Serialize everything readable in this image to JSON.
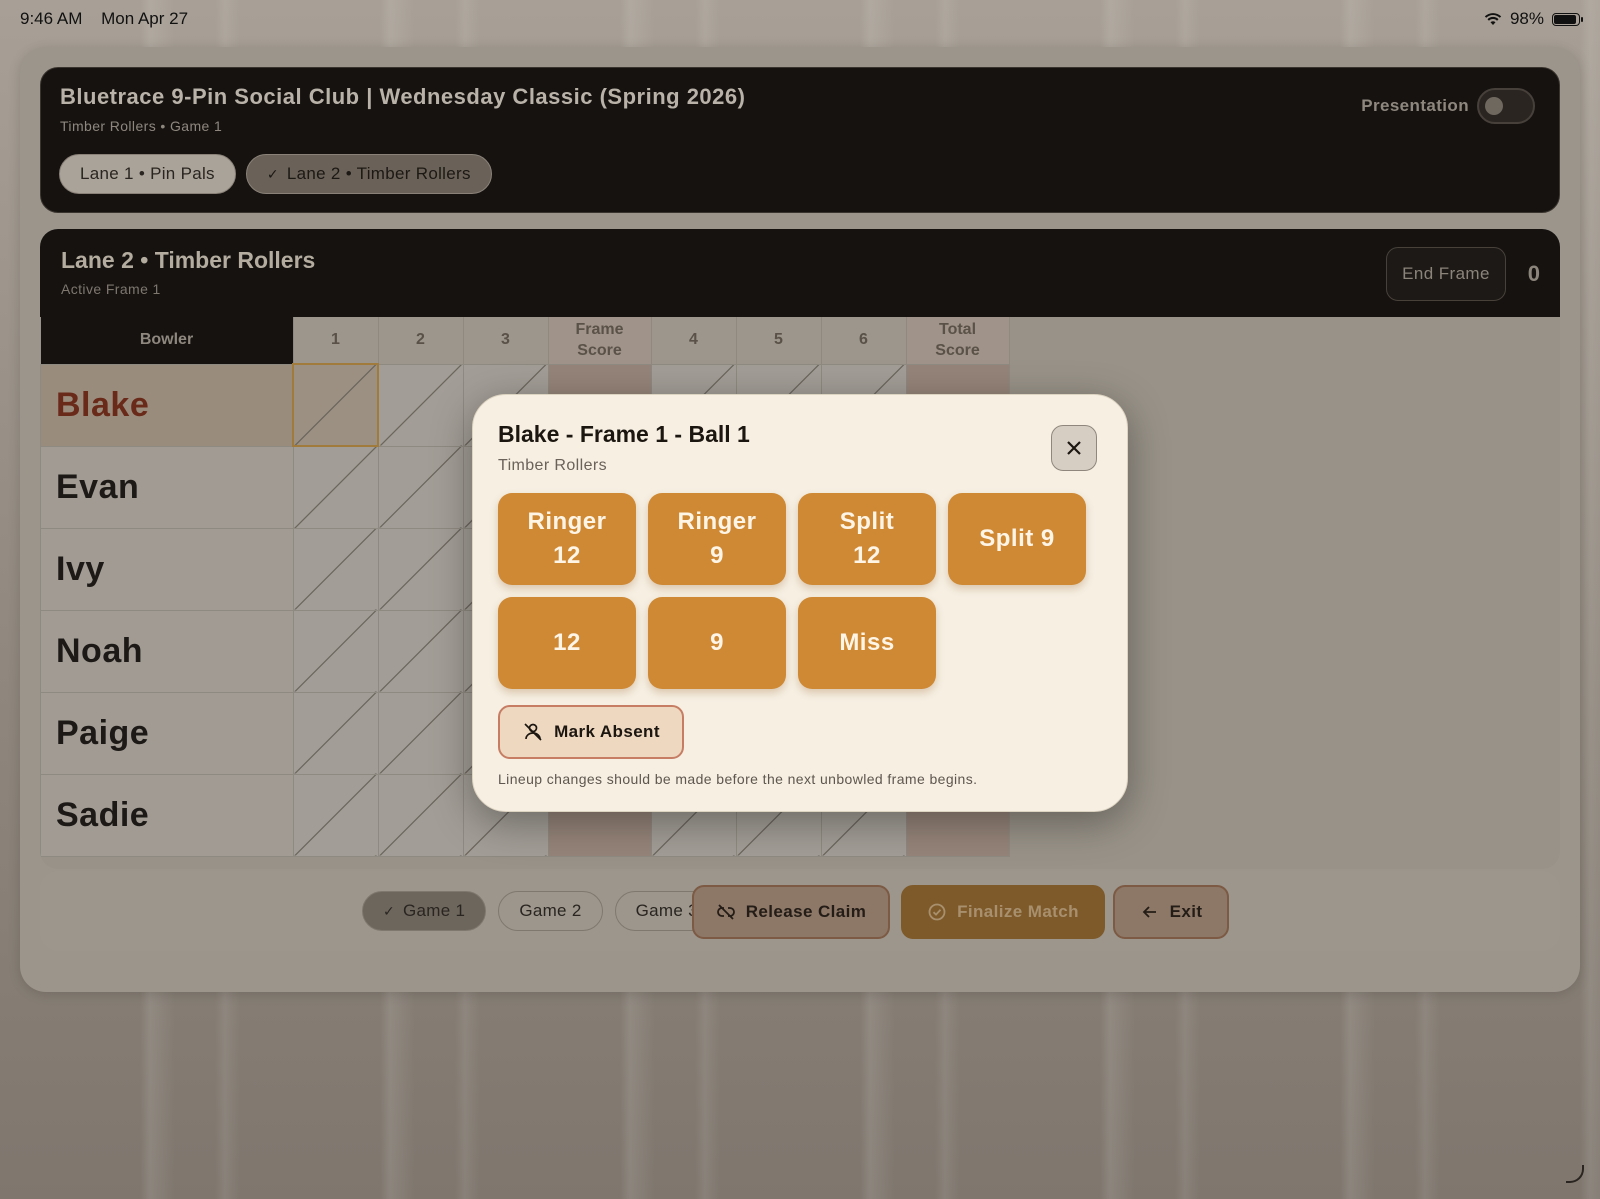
{
  "status": {
    "time": "9:46 AM",
    "date": "Mon Apr 27",
    "battery": "98%"
  },
  "header": {
    "title": "Bluetrace 9-Pin Social Club | Wednesday Classic (Spring 2026)",
    "subtitle": "Timber Rollers • Game 1",
    "presentation_label": "Presentation",
    "presentation_on": false,
    "lanes": [
      {
        "label": "Lane 1 • Pin Pals",
        "active": false
      },
      {
        "label": "Lane 2 • Timber Rollers",
        "active": true
      }
    ]
  },
  "lane": {
    "title": "Lane 2 • Timber Rollers",
    "subtitle": "Active Frame 1",
    "end_frame_label": "End Frame",
    "frame_count": "0"
  },
  "grid": {
    "headers": {
      "bowler": "Bowler",
      "c1": "1",
      "c2": "2",
      "c3": "3",
      "frame_score": "Frame\nScore",
      "c4": "4",
      "c5": "5",
      "c6": "6",
      "total_score": "Total\nScore"
    },
    "bowlers": [
      "Blake",
      "Evan",
      "Ivy",
      "Noah",
      "Paige",
      "Sadie"
    ],
    "active_bowler": "Blake"
  },
  "footer": {
    "games": [
      {
        "label": "Game 1",
        "active": true
      },
      {
        "label": "Game 2",
        "active": false
      },
      {
        "label": "Game 3",
        "active": false
      }
    ],
    "release_label": "Release Claim",
    "finalize_label": "Finalize Match",
    "exit_label": "Exit"
  },
  "modal": {
    "title": "Blake - Frame 1 - Ball 1",
    "subtitle": "Timber Rollers",
    "buttons": [
      "Ringer\n12",
      "Ringer\n9",
      "Split\n12",
      "Split 9",
      "12",
      "9",
      "Miss"
    ],
    "absent_label": "Mark Absent",
    "note": "Lineup changes should be made before the next unbowled frame begins."
  },
  "colors": {
    "accent": "#cf8935",
    "dark_panel": "#151210",
    "modal_bg": "#f6efe2",
    "active_name": "#6a2a1a"
  }
}
